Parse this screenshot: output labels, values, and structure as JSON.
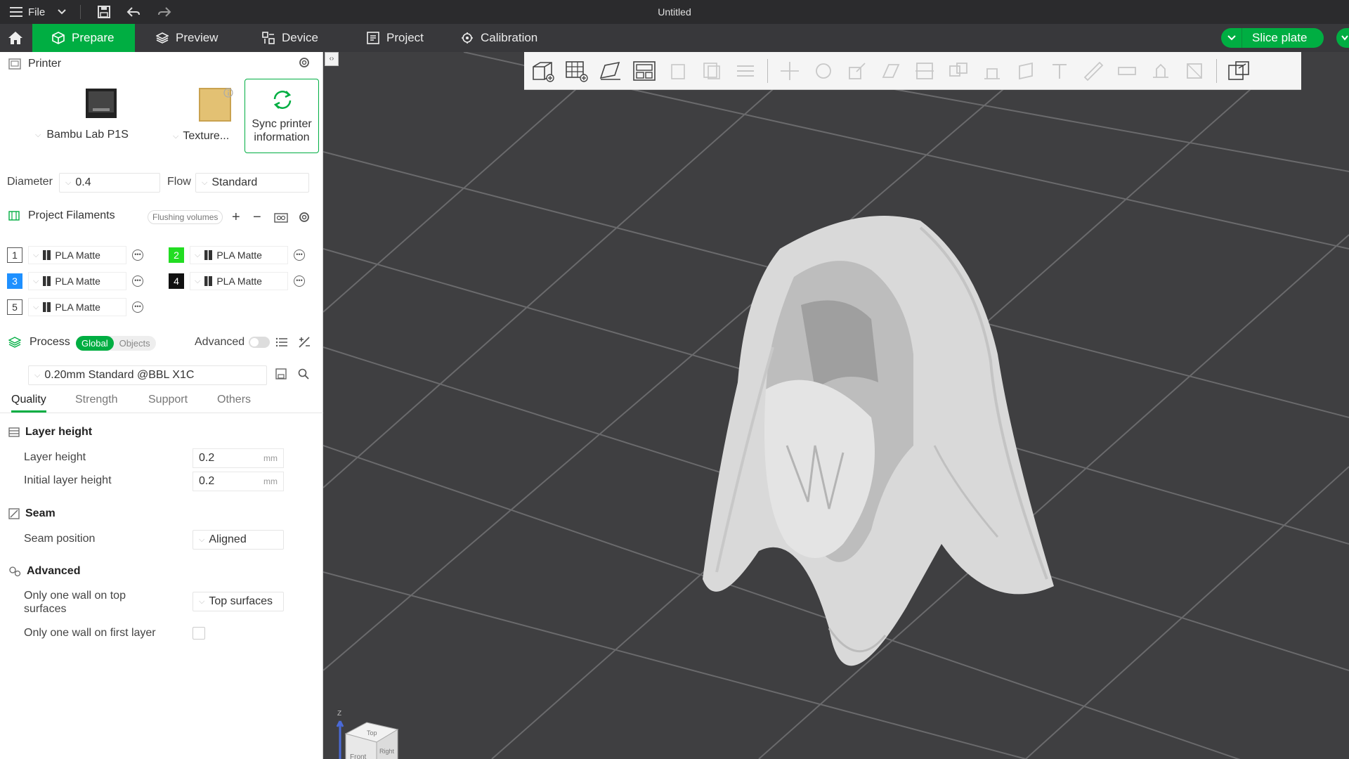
{
  "titlebar": {
    "file_label": "File",
    "title": "Untitled"
  },
  "tabs": [
    {
      "label": "Prepare",
      "icon": "cube-icon"
    },
    {
      "label": "Preview",
      "icon": "layers-icon"
    },
    {
      "label": "Device",
      "icon": "device-icon"
    },
    {
      "label": "Project",
      "icon": "project-icon"
    },
    {
      "label": "Calibration",
      "icon": "calibration-icon"
    }
  ],
  "slice": {
    "label": "Slice plate"
  },
  "printer": {
    "section_label": "Printer",
    "printer_name": "Bambu Lab P1S",
    "plate_name": "Texture...",
    "sync_label": "Sync printer information",
    "diameter_label": "Diameter",
    "diameter_value": "0.4",
    "flow_label": "Flow",
    "flow_value": "Standard"
  },
  "filaments": {
    "section_label": "Project Filaments",
    "flushing_label": "Flushing volumes",
    "items": [
      {
        "num": "1",
        "name": "PLA Matte",
        "color": "#ffffff"
      },
      {
        "num": "2",
        "name": "PLA Matte",
        "color": "#22dd22"
      },
      {
        "num": "3",
        "name": "PLA Matte",
        "color": "#1e90ff"
      },
      {
        "num": "4",
        "name": "PLA Matte",
        "color": "#111111"
      },
      {
        "num": "5",
        "name": "PLA Matte",
        "color": "#ffffff"
      }
    ]
  },
  "process": {
    "section_label": "Process",
    "global_label": "Global",
    "objects_label": "Objects",
    "advanced_label": "Advanced",
    "preset": "0.20mm Standard @BBL X1C",
    "subtabs": [
      "Quality",
      "Strength",
      "Support",
      "Others"
    ]
  },
  "quality": {
    "layer_height_group": "Layer height",
    "layer_height_label": "Layer height",
    "layer_height_value": "0.2",
    "initial_layer_height_label": "Initial layer height",
    "initial_layer_height_value": "0.2",
    "unit": "mm",
    "seam_group": "Seam",
    "seam_position_label": "Seam position",
    "seam_position_value": "Aligned",
    "advanced_group": "Advanced",
    "one_wall_top_label": "Only one wall on top surfaces",
    "one_wall_top_value": "Top surfaces",
    "one_wall_first_label": "Only one wall on first layer"
  },
  "navcube": {
    "top": "Top",
    "front": "Front",
    "right": "Right",
    "z": "Z"
  }
}
